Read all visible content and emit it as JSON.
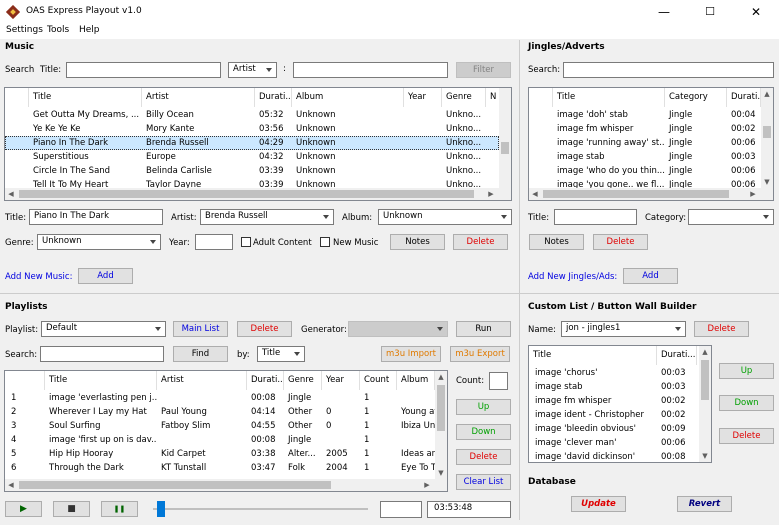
{
  "window": {
    "title": "OAS Express Playout v1.0",
    "min": "—",
    "max": "☐",
    "close": "✕"
  },
  "menu": [
    "Settings",
    "Tools",
    "Help"
  ],
  "music": {
    "heading": "Music",
    "search_label": "Search",
    "title_label": "Title:",
    "title_value": "",
    "field_select": "Artist",
    "colon": ":",
    "query_value": "",
    "filter_btn": "Filter",
    "columns": [
      "Title",
      "Artist",
      "Durati...",
      "Album",
      "Year",
      "Genre",
      "N"
    ],
    "rows": [
      [
        "Get Outta My Dreams, ...",
        "Billy Ocean",
        "05:32",
        "Unknown",
        "",
        "Unkno..."
      ],
      [
        "Ye Ke Ye Ke",
        "Mory Kante",
        "03:56",
        "Unknown",
        "",
        "Unkno..."
      ],
      [
        "Piano In The Dark",
        "Brenda Russell",
        "04:29",
        "Unknown",
        "",
        "Unkno..."
      ],
      [
        "Superstitious",
        "Europe",
        "04:32",
        "Unknown",
        "",
        "Unkno..."
      ],
      [
        "Circle In The Sand",
        "Belinda Carlisle",
        "03:39",
        "Unknown",
        "",
        "Unkno..."
      ],
      [
        "Tell It To My Heart",
        "Taylor Dayne",
        "03:39",
        "Unknown",
        "",
        "Unkno..."
      ]
    ],
    "edit": {
      "title_label": "Title:",
      "title_value": "Piano In The Dark",
      "artist_label": "Artist:",
      "artist_value": "Brenda Russell",
      "album_label": "Album:",
      "album_value": "Unknown",
      "genre_label": "Genre:",
      "genre_value": "Unknown",
      "year_label": "Year:",
      "year_value": "",
      "adult_label": "Adult Content",
      "newmusic_label": "New Music",
      "notes_btn": "Notes",
      "delete_btn": "Delete"
    },
    "add_label": "Add New Music:",
    "add_btn": "Add"
  },
  "jingles": {
    "heading": "Jingles/Adverts",
    "search_label": "Search:",
    "search_value": "",
    "columns": [
      "Title",
      "Category",
      "Durati..."
    ],
    "rows": [
      [
        "image 'doh' stab",
        "Jingle",
        "00:04"
      ],
      [
        "image fm whisper",
        "Jingle",
        "00:02"
      ],
      [
        "image 'running away' st...",
        "Jingle",
        "00:06"
      ],
      [
        "image stab",
        "Jingle",
        "00:03"
      ],
      [
        "image 'who do you thin...",
        "Jingle",
        "00:06"
      ],
      [
        "image 'you gone.. we fl...",
        "Jingle",
        "00:06"
      ]
    ],
    "title_label": "Title:",
    "title_value": "",
    "category_label": "Category:",
    "category_value": "",
    "notes_btn": "Notes",
    "delete_btn": "Delete",
    "add_label": "Add New Jingles/Ads:",
    "add_btn": "Add"
  },
  "playlists": {
    "heading": "Playlists",
    "playlist_label": "Playlist:",
    "playlist_value": "Default",
    "mainlist_btn": "Main List",
    "delete_btn": "Delete",
    "generator_label": "Generator:",
    "generator_value": "",
    "run_btn": "Run",
    "search_label": "Search:",
    "search_value": "",
    "find_btn": "Find",
    "by_label": "by:",
    "by_value": "Title",
    "m3u_import": "m3u Import",
    "m3u_export": "m3u Export",
    "columns": [
      "",
      "Title",
      "Artist",
      "Durati...",
      "Genre",
      "Year",
      "Count",
      "Album"
    ],
    "rows": [
      [
        "1",
        "image 'everlasting pen j...",
        "",
        "00:08",
        "Jingle",
        "",
        "1",
        ""
      ],
      [
        "2",
        "Wherever I Lay my Hat",
        "Paul Young",
        "04:14",
        "Other",
        "0",
        "1",
        "Young at"
      ],
      [
        "3",
        "Soul Surfing",
        "Fatboy Slim",
        "04:55",
        "Other",
        "0",
        "1",
        "Ibiza Unc"
      ],
      [
        "4",
        "image 'first up on is dav...",
        "",
        "00:08",
        "Jingle",
        "",
        "1",
        ""
      ],
      [
        "5",
        "Hip Hip Hooray",
        "Kid Carpet",
        "03:38",
        "Alter...",
        "2005",
        "1",
        "Ideas and"
      ],
      [
        "6",
        "Through the Dark",
        "KT Tunstall",
        "03:47",
        "Folk",
        "2004",
        "1",
        "Eye To Th"
      ]
    ],
    "count_label": "Count:",
    "count_value": "",
    "up_btn": "Up",
    "down_btn": "Down",
    "delete2_btn": "Delete",
    "clear_btn": "Clear List"
  },
  "custom": {
    "heading": "Custom List / Button Wall Builder",
    "name_label": "Name:",
    "name_value": "jon - jingles1",
    "delete_btn": "Delete",
    "columns": [
      "Title",
      "Durati..."
    ],
    "rows": [
      [
        "image 'chorus'",
        "00:03"
      ],
      [
        "image stab",
        "00:03"
      ],
      [
        "image fm whisper",
        "00:02"
      ],
      [
        "image ident - Christopher",
        "00:02"
      ],
      [
        "image 'bleedin obvious'",
        "00:09"
      ],
      [
        "image 'clever man'",
        "00:06"
      ],
      [
        "image 'david dickinson'",
        "00:08"
      ]
    ],
    "up_btn": "Up",
    "down_btn": "Down",
    "delete2_btn": "Delete"
  },
  "database": {
    "heading": "Database",
    "update_btn": "Update",
    "revert_btn": "Revert"
  },
  "transport": {
    "play": "▶",
    "stop": "■",
    "pause": "❚❚",
    "volume": 0.02,
    "time": "03:53:48",
    "status": ""
  }
}
